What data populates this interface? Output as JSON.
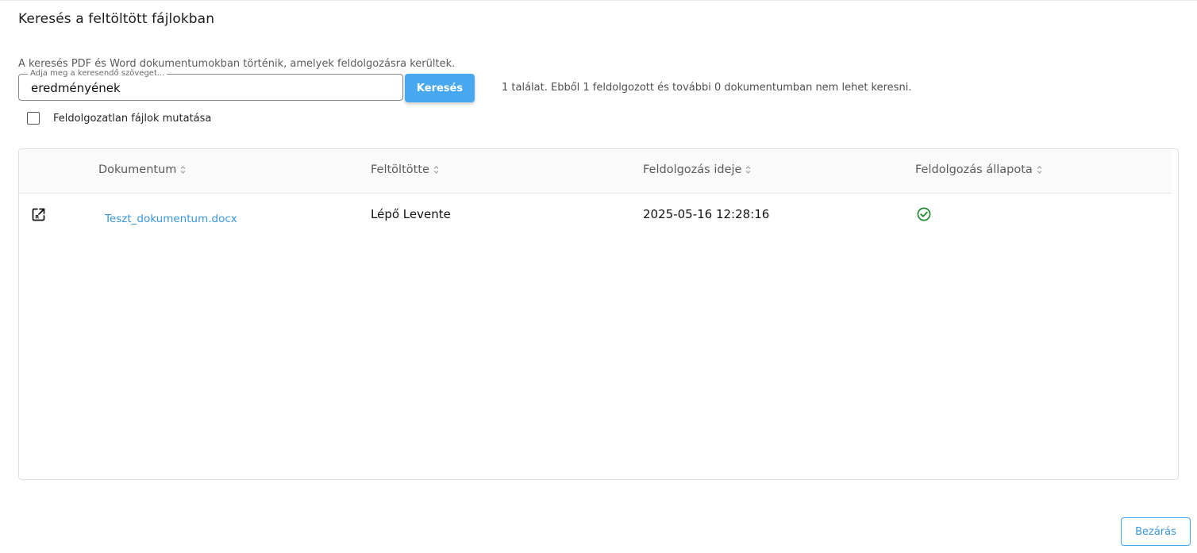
{
  "page": {
    "title": "Keresés a feltöltött fájlokban",
    "hint": "A keresés PDF és Word dokumentumokban történik, amelyek feldolgozásra kerültek."
  },
  "search": {
    "label": "Adja meg a keresendő szöveget...",
    "value": "eredményének",
    "button_label": "Keresés",
    "result_summary": "1 találat. Ebből 1 feldolgozott és további 0 dokumentumban nem lehet keresni."
  },
  "filter": {
    "show_unprocessed_label": "Feldolgozatlan fájlok mutatása",
    "show_unprocessed_checked": false
  },
  "table": {
    "columns": [
      {
        "label": "Dokumentum"
      },
      {
        "label": "Feltöltötte"
      },
      {
        "label": "Feldolgozás ideje"
      },
      {
        "label": "Feldolgozás állapota"
      }
    ],
    "rows": [
      {
        "document": "Teszt_dokumentum.docx",
        "uploaded_by": "Lépő Levente",
        "processed_at": "2025-05-16 12:28:16",
        "status_icon": "check-circle-icon"
      }
    ]
  },
  "footer": {
    "close_label": "Bezárás"
  },
  "colors": {
    "primary": "#47a8ef",
    "link": "#3a97df",
    "success": "#1e8a2e"
  }
}
